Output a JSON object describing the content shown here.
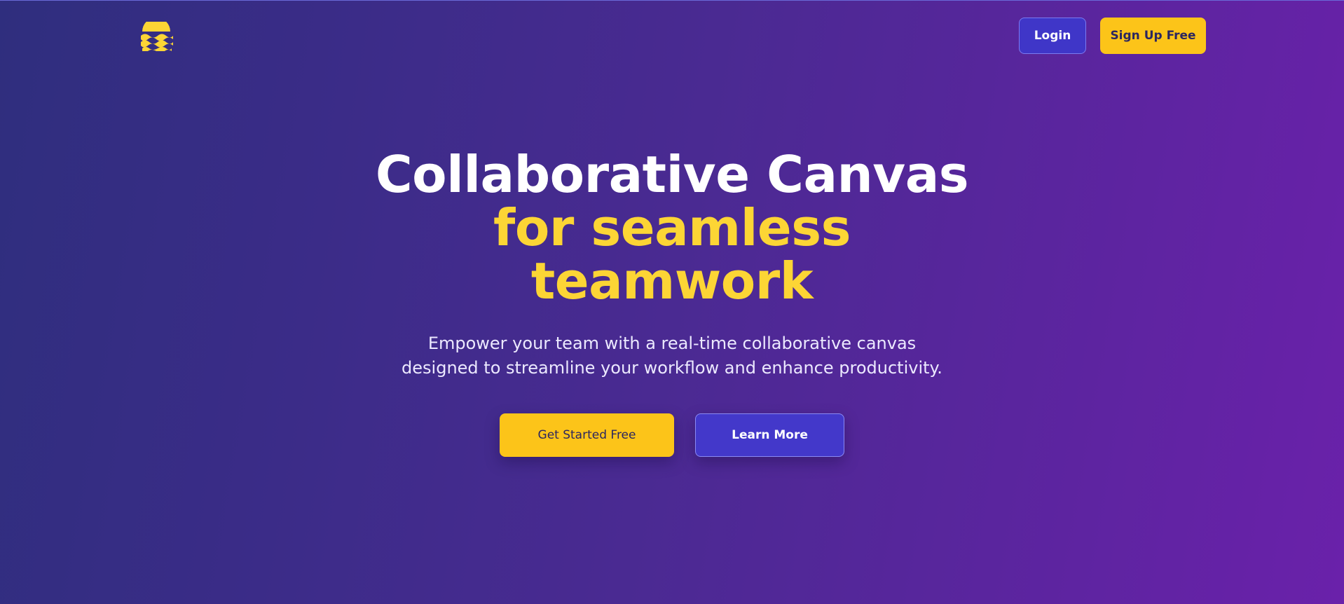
{
  "header": {
    "logo_icon": "sun-waves-icon",
    "login_label": "Login",
    "signup_label": "Sign Up Free"
  },
  "hero": {
    "title_line1": "Collaborative Canvas",
    "title_line2": "for seamless",
    "title_line3": "teamwork",
    "tagline": "Empower your team with a real-time collaborative canvas designed to streamline your workflow and enhance productivity.",
    "primary_cta": "Get Started Free",
    "secondary_cta": "Learn More"
  },
  "colors": {
    "accent_yellow": "#fcc419",
    "headline_yellow": "#fcd535",
    "button_indigo": "#4338ca",
    "gradient_start": "#2f2e7e",
    "gradient_end": "#6a21aa"
  }
}
